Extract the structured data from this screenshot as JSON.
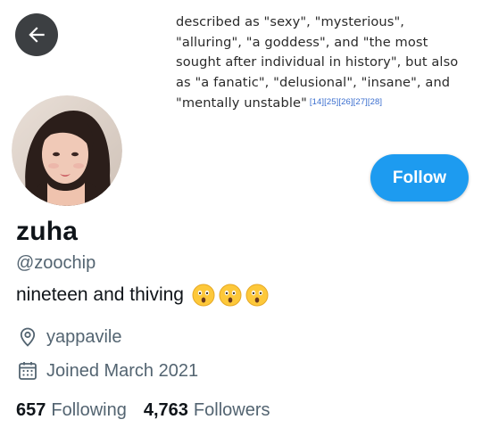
{
  "banner": {
    "lines": [
      "described as \"sexy\", \"mysterious\",",
      "\"alluring\", \"a goddess\", and \"the most",
      "sought after individual in history\", but also",
      "as  \"a fanatic\", \"delusional\", \"insane\", and",
      "\"mentally unstable\""
    ],
    "citations": "[14][25][26][27][28]"
  },
  "profile": {
    "display_name": "zuha",
    "handle": "@zoochip",
    "bio": "nineteen and thiving",
    "bio_emoji": [
      "astonished-face-emoji",
      "astonished-face-emoji",
      "astonished-face-emoji"
    ],
    "location": "yappavile",
    "joined": "Joined March 2021"
  },
  "stats": {
    "following_count": "657",
    "following_label": "Following",
    "followers_count": "4,763",
    "followers_label": "Followers"
  },
  "actions": {
    "follow_label": "Follow",
    "back_icon": "arrow-left-icon"
  },
  "colors": {
    "accent": "#1d9bf0",
    "back_button_bg": "#3c3f42",
    "secondary_text": "#536471",
    "primary_text": "#0f1419",
    "citation": "#3a6ecf"
  }
}
